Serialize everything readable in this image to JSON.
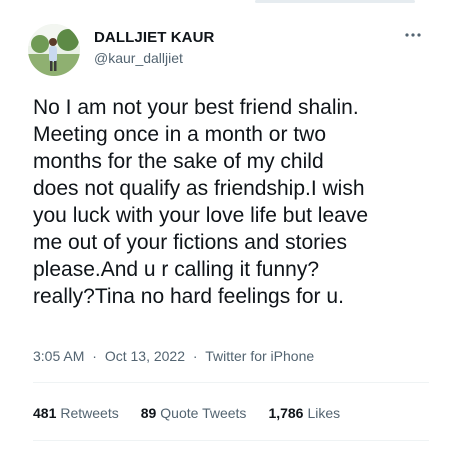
{
  "author": {
    "display_name": "DALLJIET KAUR",
    "handle": "@kaur_dalljiet"
  },
  "menu_icon": "more-dots-icon",
  "tweet": {
    "text": "No I am not your best friend shalin.\nMeeting once in a month or two\nmonths for the sake of my child\ndoes not qualify as friendship.I wish\nyou luck with your love life but leave\nme out of your fictions and stories\nplease.And u r calling it funny?\nreally?Tina no hard feelings for u.",
    "time": "3:05 AM",
    "separator": "·",
    "date": "Oct 13, 2022",
    "source": "Twitter for iPhone"
  },
  "stats": {
    "retweets_count": "481",
    "retweets_label": "Retweets",
    "quotes_count": "89",
    "quotes_label": "Quote Tweets",
    "likes_count": "1,786",
    "likes_label": "Likes"
  },
  "colors": {
    "text_primary": "#0f1419",
    "text_secondary": "#536471",
    "divider": "#eff3f4"
  }
}
